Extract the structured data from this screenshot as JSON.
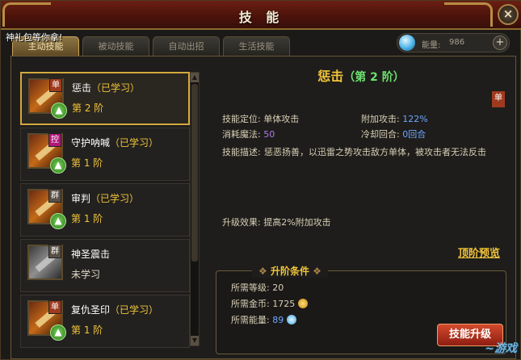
{
  "window": {
    "title": "技 能",
    "close_label": "×"
  },
  "gift_text": "神礼包等你拿!",
  "tabs": [
    {
      "label": "主动技能",
      "active": true
    },
    {
      "label": "被动技能",
      "active": false
    },
    {
      "label": "自动出招",
      "active": false
    },
    {
      "label": "生活技能",
      "active": false
    }
  ],
  "energy": {
    "label": "能量:",
    "value": "986",
    "plus": "+"
  },
  "skills": [
    {
      "name": "惩击",
      "status": "（已学习）",
      "level": "第 2 阶",
      "badge": "单",
      "learned": true
    },
    {
      "name": "守护呐喊",
      "status": "（已学习）",
      "level": "第 1 阶",
      "badge": "控",
      "learned": true
    },
    {
      "name": "审判",
      "status": "（已学习）",
      "level": "第 1 阶",
      "badge": "群",
      "learned": true
    },
    {
      "name": "神圣震击",
      "status": "",
      "level": "未学习",
      "badge": "群",
      "learned": false
    },
    {
      "name": "复仇圣印",
      "status": "（已学习）",
      "level": "第 1 阶",
      "badge": "单",
      "learned": true
    }
  ],
  "detail": {
    "name": "惩击",
    "level": "（第 2 阶）",
    "badge": "单",
    "positioning_key": "技能定位:",
    "positioning_val": "单体攻击",
    "extra_attack_key": "附加攻击:",
    "extra_attack_val": "122%",
    "mana_key": "消耗魔法:",
    "mana_val": "50",
    "cooldown_key": "冷却回合:",
    "cooldown_val": "0回合",
    "desc_key": "技能描述:",
    "desc_val": "惩恶扬善，以迅雷之势攻击敌方单体，被攻击者无法反击",
    "effect_key": "升级效果:",
    "effect_val": "提高2%附加攻击",
    "preview_link": "顶阶预览"
  },
  "conditions": {
    "title": "升阶条件",
    "level_key": "所需等级:",
    "level_val": "20",
    "gold_key": "所需金币:",
    "gold_val": "1725",
    "energy_key": "所需能量:",
    "energy_val": "89",
    "button": "技能升级"
  }
}
